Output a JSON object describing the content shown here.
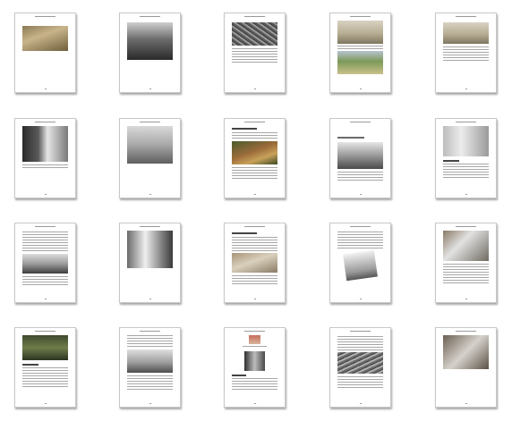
{
  "view": {
    "type": "page-thumbnail-grid",
    "rows": 4,
    "columns": 5,
    "page_count": 20
  },
  "pages": [
    {
      "label": "page-1"
    },
    {
      "label": "page-2"
    },
    {
      "label": "page-3"
    },
    {
      "label": "page-4"
    },
    {
      "label": "page-5"
    },
    {
      "label": "page-6"
    },
    {
      "label": "page-7"
    },
    {
      "label": "page-8"
    },
    {
      "label": "page-9"
    },
    {
      "label": "page-10"
    },
    {
      "label": "page-11"
    },
    {
      "label": "page-12"
    },
    {
      "label": "page-13"
    },
    {
      "label": "page-14"
    },
    {
      "label": "page-15"
    },
    {
      "label": "page-16"
    },
    {
      "label": "page-17"
    },
    {
      "label": "page-18"
    },
    {
      "label": "page-19"
    },
    {
      "label": "page-20"
    }
  ]
}
